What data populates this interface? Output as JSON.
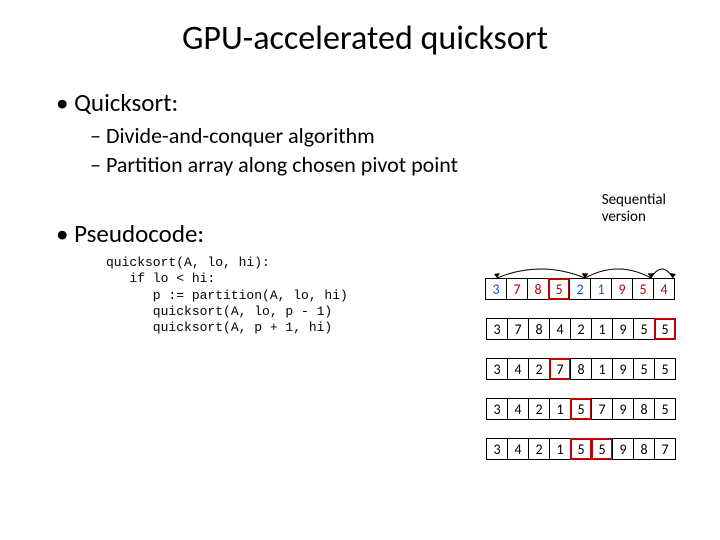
{
  "title": "GPU-accelerated quicksort",
  "bullet1": "Quicksort:",
  "sub1": "Divide-and-conquer algorithm",
  "sub2": "Partition array along chosen pivot point",
  "bullet2": "Pseudocode:",
  "pseudocode": "quicksort(A, lo, hi):\n   if lo < hi:\n      p := partition(A, lo, hi)\n      quicksort(A, lo, p - 1)\n      quicksort(A, p + 1, hi)",
  "seq_label_1": "Sequential",
  "seq_label_2": "version",
  "chart_data": {
    "type": "table",
    "description": "Five successive states of a 9-element array during quicksort partitioning. Pivot cells outlined red; elements less than current pivot shown blue, greater-or-equal shown red in first row.",
    "rows": [
      {
        "values": [
          3,
          7,
          8,
          5,
          2,
          1,
          9,
          5,
          4
        ],
        "colors": [
          "blue",
          "red",
          "red",
          "red",
          "blue",
          "blue",
          "red",
          "red",
          "red"
        ],
        "pivot_indices": [
          3
        ],
        "arrows": [
          [
            0,
            4
          ],
          [
            4,
            7
          ],
          [
            7,
            8
          ]
        ]
      },
      {
        "values": [
          3,
          7,
          8,
          4,
          2,
          1,
          9,
          5,
          5
        ],
        "colors": [
          "",
          "",
          "",
          "",
          "",
          "",
          "",
          "",
          ""
        ],
        "pivot_indices": [
          8
        ],
        "arrows": []
      },
      {
        "values": [
          3,
          4,
          2,
          7,
          8,
          1,
          9,
          5,
          5
        ],
        "colors": [
          "",
          "",
          "",
          "",
          "",
          "",
          "",
          "",
          ""
        ],
        "pivot_indices": [
          3
        ],
        "arrows": []
      },
      {
        "values": [
          3,
          4,
          2,
          1,
          5,
          7,
          9,
          8,
          5
        ],
        "colors": [
          "",
          "",
          "",
          "",
          "",
          "",
          "",
          "",
          ""
        ],
        "pivot_indices": [
          4
        ],
        "arrows": []
      },
      {
        "values": [
          3,
          4,
          2,
          1,
          5,
          5,
          9,
          8,
          7
        ],
        "colors": [
          "",
          "",
          "",
          "",
          "",
          "",
          "",
          "",
          ""
        ],
        "pivot_indices": [
          4,
          5
        ],
        "arrows": []
      }
    ]
  }
}
